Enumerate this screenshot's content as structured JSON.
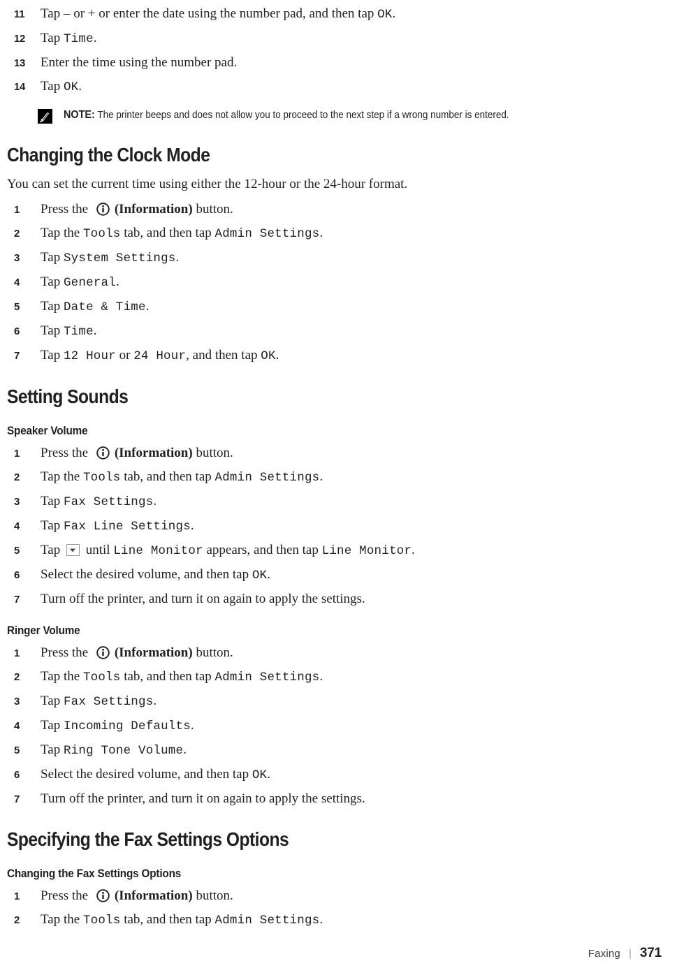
{
  "document": {
    "footer": {
      "chapter": "Faxing",
      "separator": "|",
      "page_number": "371"
    }
  },
  "continued_steps": {
    "items": [
      {
        "num": "11",
        "pre": "Tap – or + or enter the date using the number pad, and then tap ",
        "code": "OK",
        "post": "."
      },
      {
        "num": "12",
        "pre": "Tap ",
        "code": "Time",
        "post": "."
      },
      {
        "num": "13",
        "pre": "Enter the time using the number pad.",
        "code": "",
        "post": ""
      },
      {
        "num": "14",
        "pre": "Tap ",
        "code": "OK",
        "post": "."
      }
    ]
  },
  "note": {
    "icon": "note-pencil-icon",
    "label": "NOTE:",
    "text": "The printer beeps and does not allow you to proceed to the next step if a wrong number is entered."
  },
  "sections": [
    {
      "id": "changing-the-clock-mode",
      "heading": "Changing the Clock Mode",
      "intro": "You can set the current time using either the 12-hour or the 24-hour format.",
      "steps": [
        {
          "num": "1",
          "pre": "Press the ",
          "icon": "information-icon",
          "mid_bold": "(Information)",
          "post": " button."
        },
        {
          "num": "2",
          "pre": "Tap the ",
          "code1": "Tools",
          "mid": " tab, and then tap ",
          "code2": "Admin Settings",
          "post": "."
        },
        {
          "num": "3",
          "pre": "Tap ",
          "code1": "System Settings",
          "post": "."
        },
        {
          "num": "4",
          "pre": "Tap ",
          "code1": "General",
          "post": "."
        },
        {
          "num": "5",
          "pre": "Tap ",
          "code1": "Date & Time",
          "post": "."
        },
        {
          "num": "6",
          "pre": "Tap ",
          "code1": "Time",
          "post": "."
        },
        {
          "num": "7",
          "pre": "Tap ",
          "code1": "12 Hour",
          "mid": " or ",
          "code2": "24 Hour",
          "mid2": ", and then tap ",
          "code3": "OK",
          "post": "."
        }
      ]
    },
    {
      "id": "setting-sounds",
      "heading": "Setting Sounds",
      "subsections": [
        {
          "id": "speaker-volume",
          "subheading": "Speaker Volume",
          "steps": [
            {
              "num": "1",
              "pre": "Press the ",
              "icon": "information-icon",
              "mid_bold": "(Information)",
              "post": " button."
            },
            {
              "num": "2",
              "pre": "Tap the ",
              "code1": "Tools",
              "mid": " tab, and then tap ",
              "code2": "Admin Settings",
              "post": "."
            },
            {
              "num": "3",
              "pre": "Tap ",
              "code1": "Fax Settings",
              "post": "."
            },
            {
              "num": "4",
              "pre": "Tap ",
              "code1": "Fax Line Settings",
              "post": "."
            },
            {
              "num": "5",
              "pre": "Tap ",
              "button": "scroll-down-button",
              "mid": " until ",
              "code1": "Line Monitor",
              "mid2": " appears, and then tap ",
              "code2": "Line Monitor",
              "post": "."
            },
            {
              "num": "6",
              "pre": "Select the desired volume, and then tap ",
              "code1": "OK",
              "post": "."
            },
            {
              "num": "7",
              "pre": "Turn off the printer, and turn it on again to apply the settings.",
              "post": ""
            }
          ]
        },
        {
          "id": "ringer-volume",
          "subheading": "Ringer Volume",
          "steps": [
            {
              "num": "1",
              "pre": "Press the ",
              "icon": "information-icon",
              "mid_bold": "(Information)",
              "post": " button."
            },
            {
              "num": "2",
              "pre": "Tap the ",
              "code1": "Tools",
              "mid": " tab, and then tap ",
              "code2": "Admin Settings",
              "post": "."
            },
            {
              "num": "3",
              "pre": "Tap ",
              "code1": "Fax Settings",
              "post": "."
            },
            {
              "num": "4",
              "pre": "Tap ",
              "code1": "Incoming Defaults",
              "post": "."
            },
            {
              "num": "5",
              "pre": "Tap ",
              "code1": "Ring Tone Volume",
              "post": "."
            },
            {
              "num": "6",
              "pre": "Select the desired volume, and then tap ",
              "code1": "OK",
              "post": "."
            },
            {
              "num": "7",
              "pre": "Turn off the printer, and turn it on again to apply the settings.",
              "post": ""
            }
          ]
        }
      ]
    },
    {
      "id": "specifying-the-fax-settings-options",
      "heading": "Specifying the Fax Settings Options",
      "subsections": [
        {
          "id": "changing-the-fax-settings-options",
          "subheading": "Changing the Fax Settings Options",
          "steps": [
            {
              "num": "1",
              "pre": "Press the ",
              "icon": "information-icon",
              "mid_bold": "(Information)",
              "post": " button."
            },
            {
              "num": "2",
              "pre": "Tap the ",
              "code1": "Tools",
              "mid": " tab, and then tap ",
              "code2": "Admin Settings",
              "post": "."
            }
          ]
        }
      ]
    }
  ]
}
